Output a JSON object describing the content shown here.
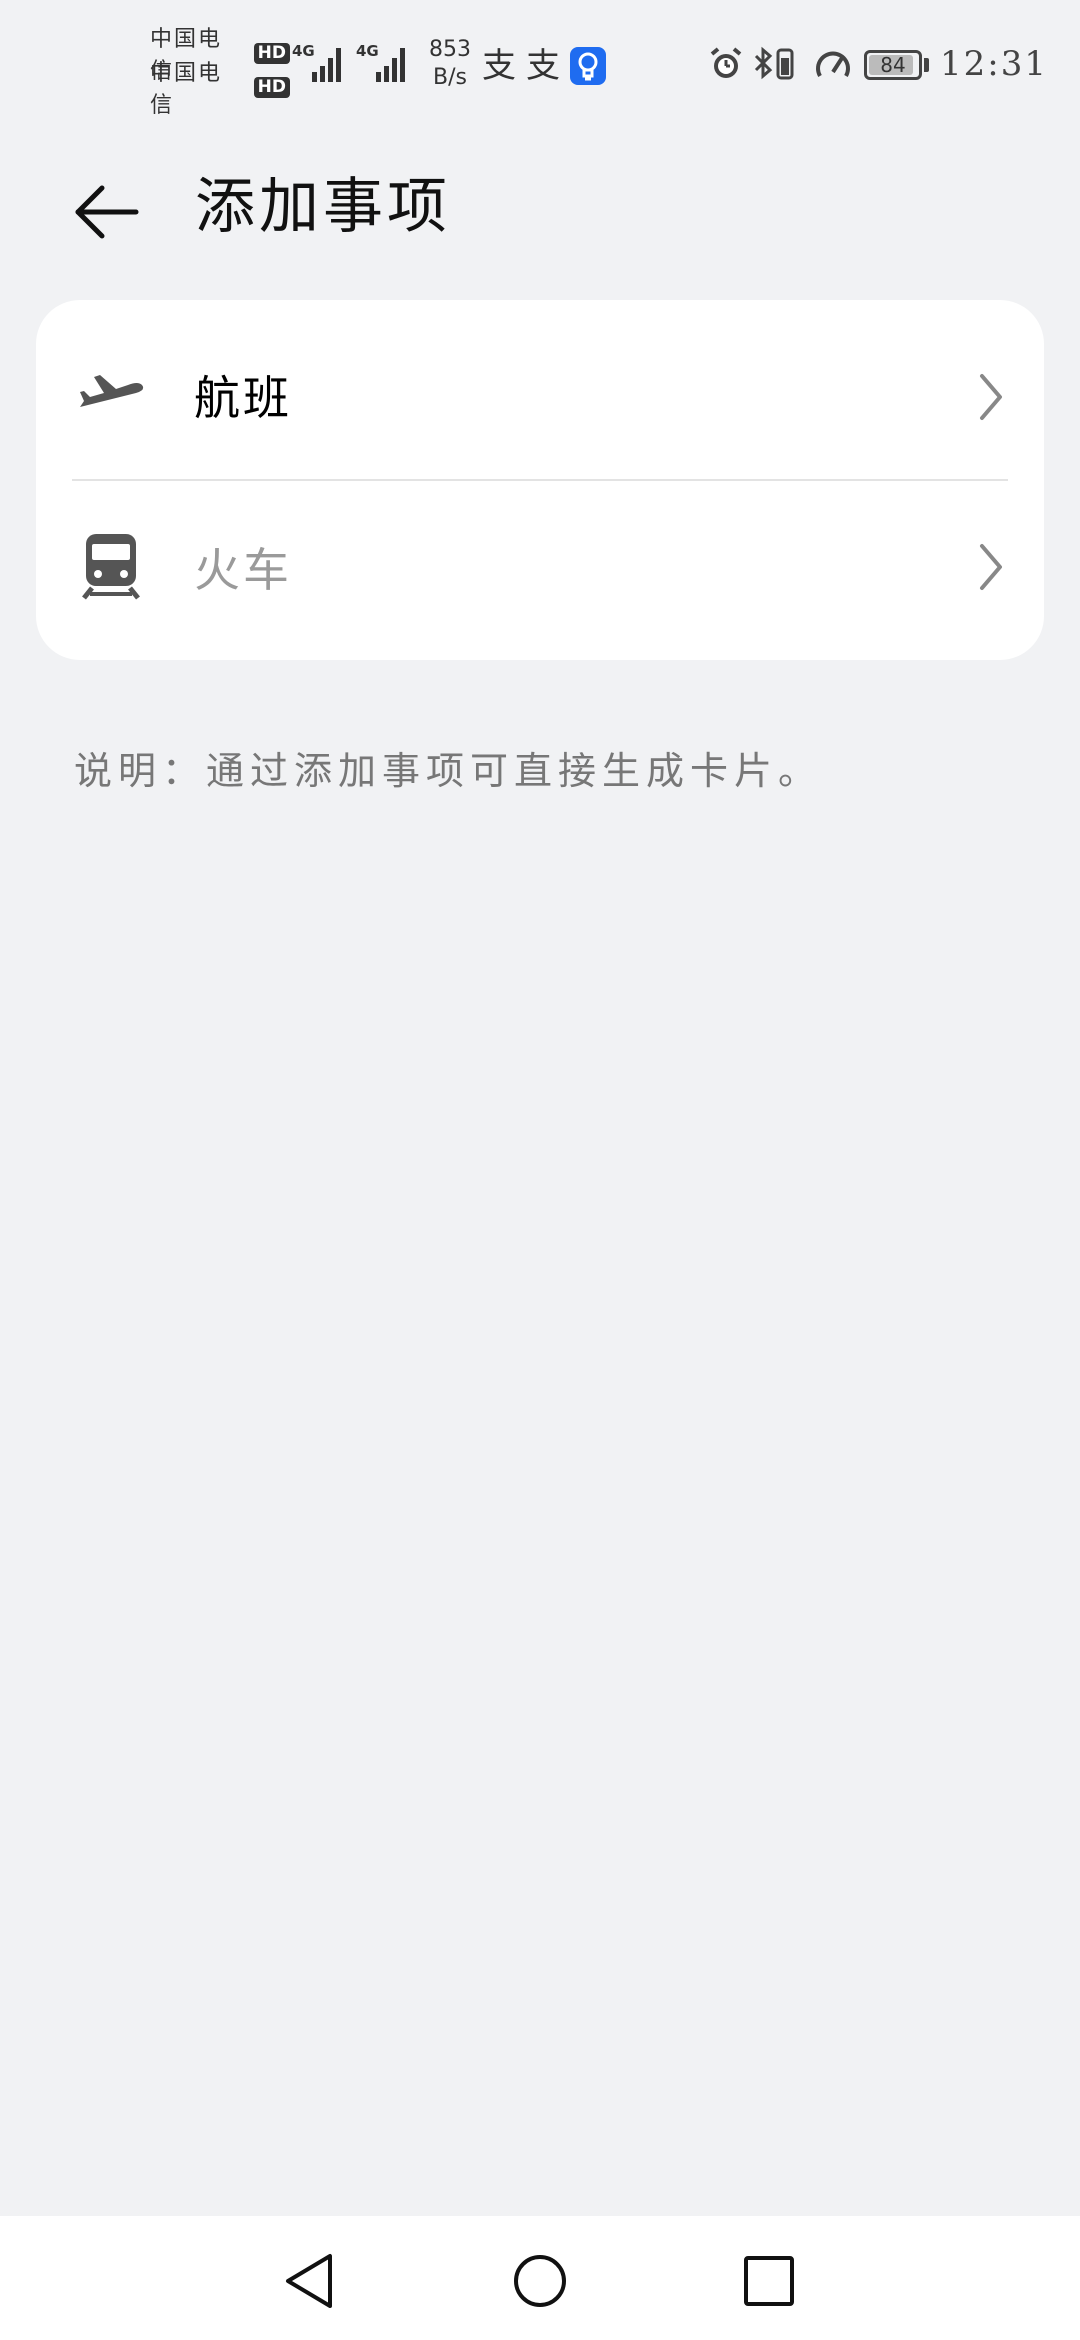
{
  "status_bar": {
    "carrier_1": "中国电信",
    "carrier_2": "中国电信",
    "hd_badge": "HD",
    "network_1": "4G",
    "network_2": "4G",
    "speed_value": "853",
    "speed_unit": "B/s",
    "pay_icon_glyph": "支",
    "battery_level": "84",
    "time": "12:31"
  },
  "header": {
    "title": "添加事项"
  },
  "items": [
    {
      "label": "航班",
      "icon": "airplane-icon",
      "label_color": "#111111"
    },
    {
      "label": "火车",
      "icon": "train-icon",
      "label_color": "#9a9a9a"
    }
  ],
  "note": {
    "text": "说明：通过添加事项可直接生成卡片。"
  },
  "colors": {
    "background": "#f1f2f4",
    "card": "#ffffff",
    "bulb_accent": "#1f6cf0"
  }
}
